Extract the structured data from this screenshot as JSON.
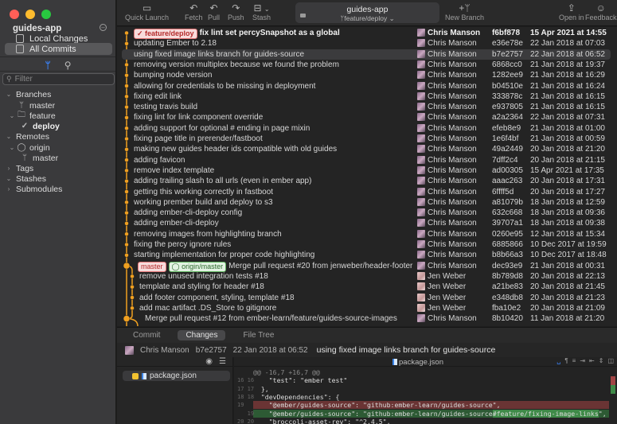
{
  "window": {
    "traffic_lights": [
      "close",
      "minimize",
      "zoom"
    ]
  },
  "sidebar": {
    "repo_name": "guides-app",
    "collapse_icon": "minus-circle-icon",
    "nav": [
      {
        "label": "Local Changes",
        "icon": "local-changes-icon"
      },
      {
        "label": "All Commits",
        "icon": "all-commits-icon",
        "selected": true
      }
    ],
    "tabs": [
      {
        "icon": "branch-icon",
        "active": true
      },
      {
        "icon": "search-icon"
      }
    ],
    "filter_placeholder": "Filter",
    "tree": [
      {
        "label": "Branches",
        "chevron": "⌄",
        "level": 0
      },
      {
        "label": "master",
        "icon": "branch-icon",
        "level": 2
      },
      {
        "label": "feature",
        "chevron": "⌄",
        "icon": "folder-icon",
        "level": 1
      },
      {
        "label": "deploy",
        "icon": "checkmark-icon",
        "level": 2,
        "current": true
      },
      {
        "label": "Remotes",
        "chevron": "⌄",
        "level": 0
      },
      {
        "label": "origin",
        "chevron": "⌄",
        "icon": "github-icon",
        "level": 1
      },
      {
        "label": "master",
        "icon": "remote-branch-icon",
        "level": 2
      },
      {
        "label": "Tags",
        "chevron": "›",
        "level": 0
      },
      {
        "label": "Stashes",
        "chevron": "⌄",
        "level": 0
      },
      {
        "label": "Submodules",
        "chevron": "›",
        "level": 0
      }
    ]
  },
  "toolbar": {
    "quick_launch": "Quick Launch",
    "fetch": "Fetch",
    "pull": "Pull",
    "push": "Push",
    "stash": "Stash",
    "repo_title": "guides-app",
    "current_branch": "feature/deploy",
    "new_branch": "New Branch",
    "open_in": "Open in",
    "feedback": "Feedback"
  },
  "commits": [
    {
      "message": "fix lint set percySnapshot as a global",
      "tags": [
        {
          "label": "feature/deploy",
          "style": "red",
          "check": true
        }
      ],
      "author": "Chris Manson",
      "sha": "f6bf878",
      "date": "15 Apr 2021 at 14:55",
      "bold": true
    },
    {
      "message": "updating Ember to 2.18",
      "author": "Chris Manson",
      "sha": "e36e78e",
      "date": "22 Jan 2018 at 07:03"
    },
    {
      "message": "using fixed image links branch for guides-source",
      "author": "Chris Manson",
      "sha": "b7e2757",
      "date": "22 Jan 2018 at 06:52",
      "selected": true
    },
    {
      "message": "removing version multiplex because we found the problem",
      "author": "Chris Manson",
      "sha": "6868cc0",
      "date": "21 Jan 2018 at 19:37"
    },
    {
      "message": "bumping node version",
      "author": "Chris Manson",
      "sha": "1282ee9",
      "date": "21 Jan 2018 at 16:29"
    },
    {
      "message": "allowing for credentials to be missing in deployment",
      "author": "Chris Manson",
      "sha": "b04510e",
      "date": "21 Jan 2018 at 16:24"
    },
    {
      "message": "fixing edit link",
      "author": "Chris Manson",
      "sha": "333878c",
      "date": "21 Jan 2018 at 16:15"
    },
    {
      "message": "testing travis build",
      "author": "Chris Manson",
      "sha": "e937805",
      "date": "21 Jan 2018 at 16:15"
    },
    {
      "message": "fixing lint for link component override",
      "author": "Chris Manson",
      "sha": "a2a2364",
      "date": "22 Jan 2018 at 07:31"
    },
    {
      "message": "adding support for optional # ending in page mixin",
      "author": "Chris Manson",
      "sha": "efeb8e9",
      "date": "21 Jan 2018 at 01:00"
    },
    {
      "message": "fixing page title in prerender/fastboot",
      "author": "Chris Manson",
      "sha": "1e6f4bf",
      "date": "21 Jan 2018 at 00:59"
    },
    {
      "message": "making new guides header ids compatible with old guides",
      "author": "Chris Manson",
      "sha": "49a2449",
      "date": "20 Jan 2018 at 21:20"
    },
    {
      "message": "adding favicon",
      "author": "Chris Manson",
      "sha": "7dff2c4",
      "date": "20 Jan 2018 at 21:15"
    },
    {
      "message": "remove index template",
      "author": "Chris Manson",
      "sha": "ad00305",
      "date": "15 Apr 2021 at 17:35"
    },
    {
      "message": "adding trailing slash to all urls (even in ember app)",
      "author": "Chris Manson",
      "sha": "aaac263",
      "date": "20 Jan 2018 at 17:31"
    },
    {
      "message": "getting this working correctly in fastboot",
      "author": "Chris Manson",
      "sha": "6ffff5d",
      "date": "20 Jan 2018 at 17:27"
    },
    {
      "message": "working prember build and deploy to s3",
      "author": "Chris Manson",
      "sha": "a81079b",
      "date": "18 Jan 2018 at 12:59"
    },
    {
      "message": "adding ember-cli-deploy config",
      "author": "Chris Manson",
      "sha": "632c668",
      "date": "18 Jan 2018 at 09:36"
    },
    {
      "message": "adding ember-cli-deploy",
      "author": "Chris Manson",
      "sha": "39707a1",
      "date": "18 Jan 2018 at 09:38"
    },
    {
      "message": "removing images from highlighting branch",
      "author": "Chris Manson",
      "sha": "0260e95",
      "date": "12 Jan 2018 at 15:34"
    },
    {
      "message": "fixing the percy ignore rules",
      "author": "Chris Manson",
      "sha": "6885866",
      "date": "10 Dec 2017 at 19:59"
    },
    {
      "message": "starting implementation for proper code highlighting",
      "author": "Chris Manson",
      "sha": "b8b66a3",
      "date": "10 Dec 2017 at 18:48"
    },
    {
      "message": "Merge pull request #20 from jenweber/header-footer",
      "tags": [
        {
          "label": "master",
          "style": "red"
        },
        {
          "label": "origin/master",
          "style": "green",
          "github": true
        }
      ],
      "author": "Chris Manson",
      "sha": "dec93e9",
      "date": "21 Jan 2018 at 00:31",
      "merge": true
    },
    {
      "message": "remove unused integration tests #18",
      "author": "Jen Weber",
      "sha": "8b789d8",
      "date": "20 Jan 2018 at 22:13",
      "lane": 1
    },
    {
      "message": "template and styling for header #18",
      "author": "Jen Weber",
      "sha": "a21be83",
      "date": "20 Jan 2018 at 21:45",
      "lane": 1
    },
    {
      "message": "add footer component, styling, template #18",
      "author": "Jen Weber",
      "sha": "e348db8",
      "date": "20 Jan 2018 at 21:23",
      "lane": 1
    },
    {
      "message": "add mac artifact .DS_Store to gitignore",
      "author": "Jen Weber",
      "sha": "fba10e2",
      "date": "20 Jan 2018 at 21:09",
      "lane": 1
    },
    {
      "message": "Merge pull request #12 from ember-learn/feature/guides-source-images",
      "author": "Chris Manson",
      "sha": "8b10420",
      "date": "11 Jan 2018 at 21:20",
      "merge": true,
      "indent": 2
    }
  ],
  "colors": {
    "graph": "#f0a020",
    "tag_red": "#e27575",
    "tag_green": "#5fb35f",
    "diff_del": "#6a3434",
    "diff_add": "#2d5a34"
  },
  "bottom_tabs": [
    {
      "label": "Commit"
    },
    {
      "label": "Changes",
      "active": true
    },
    {
      "label": "File Tree"
    }
  ],
  "commit_info": {
    "author": "Chris Manson",
    "sha": "b7e2757",
    "date": "22 Jan 2018 at 06:52",
    "message": "using fixed image links branch for guides-source"
  },
  "file_pane": {
    "files": [
      {
        "name": "package.json",
        "status": "modified"
      }
    ]
  },
  "diff": {
    "file": "package.json",
    "lines": [
      {
        "type": "hunk",
        "old": "",
        "new": "",
        "text": "@@ -16,7 +16,7 @@"
      },
      {
        "type": "ctx",
        "old": "16",
        "new": "16",
        "text": "    \"test\": \"ember test\""
      },
      {
        "type": "ctx",
        "old": "17",
        "new": "17",
        "text": "  },"
      },
      {
        "type": "ctx",
        "old": "18",
        "new": "18",
        "text": "  \"devDependencies\": {"
      },
      {
        "type": "del",
        "old": "19",
        "new": "",
        "text": "    \"@ember/guides-source\": \"github:ember-learn/guides-source\","
      },
      {
        "type": "add",
        "old": "",
        "new": "19",
        "text_before": "    \"@ember/guides-source\": \"github:ember-learn/guides-source",
        "text_hl": "#feature/fixing-image-links",
        "text_after": "\","
      },
      {
        "type": "ctx",
        "old": "20",
        "new": "20",
        "text": "    \"broccoli-asset-rev\": \"^2.4.5\","
      }
    ]
  }
}
